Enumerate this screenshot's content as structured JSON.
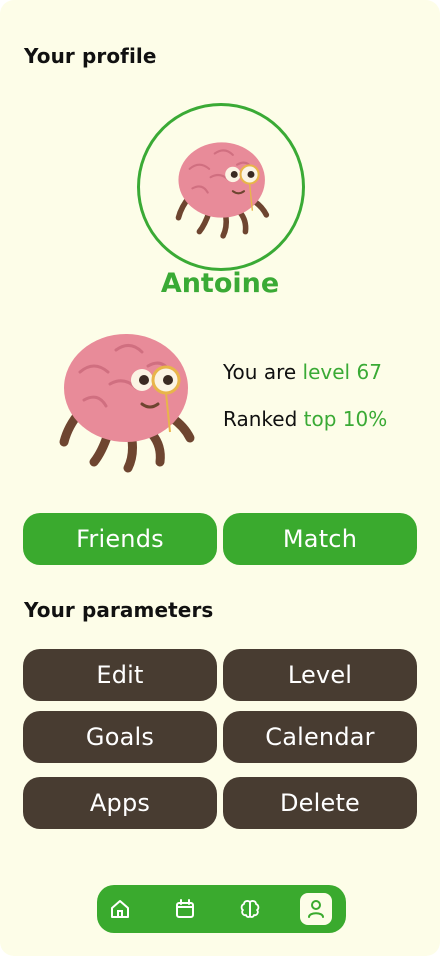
{
  "header": {
    "profile_title": "Your profile"
  },
  "profile": {
    "username": "Antoine",
    "level_prefix": "You are",
    "level_value": "level 67",
    "rank_prefix": "Ranked",
    "rank_value": "top 10%"
  },
  "social_buttons": {
    "friends": "Friends",
    "match": "Match"
  },
  "parameters": {
    "title": "Your parameters",
    "edit": "Edit",
    "level": "Level",
    "goals": "Goals",
    "calendar": "Calendar",
    "apps": "Apps",
    "delete": "Delete"
  },
  "nav": {
    "items": [
      "home-icon",
      "calendar-icon",
      "brain-icon",
      "user-icon"
    ],
    "active": "user-icon"
  },
  "colors": {
    "background": "#fdfde8",
    "accent_green": "#3aaa2e",
    "button_brown": "#483c31"
  }
}
